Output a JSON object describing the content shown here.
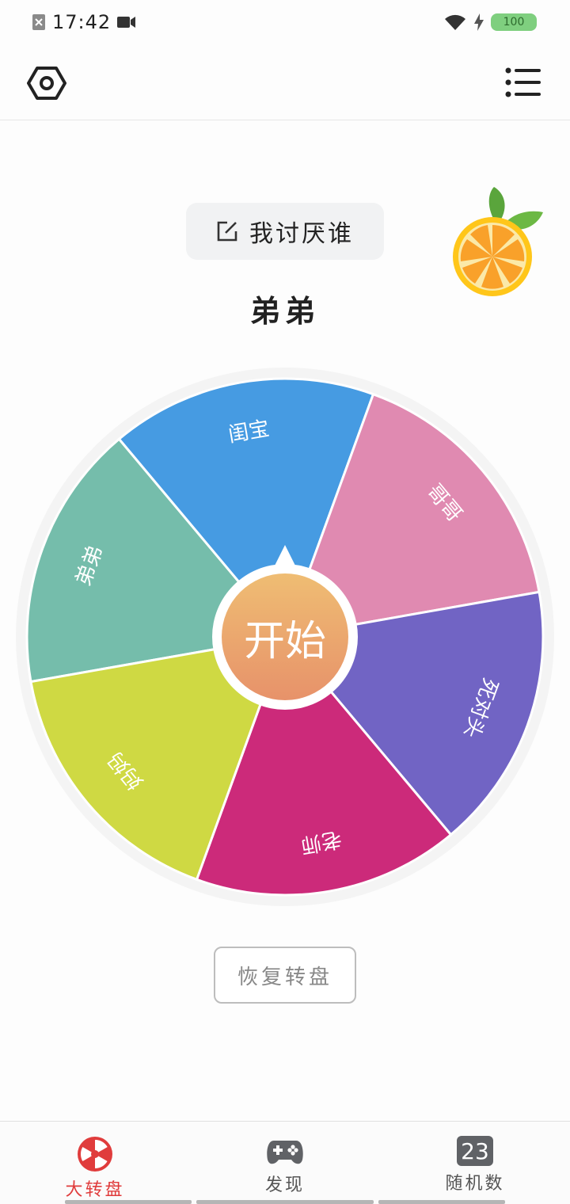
{
  "status_bar": {
    "time": "17:42",
    "battery": "100"
  },
  "header": {
    "settings_icon": "gear-hexagon-icon",
    "menu_icon": "list-icon"
  },
  "title": {
    "text": "我讨厌谁",
    "icon": "edit-icon"
  },
  "result": "弟弟",
  "wheel": {
    "start_label": "开始",
    "segments": [
      {
        "label": "弟弟",
        "color": "#75bdab"
      },
      {
        "label": "闺宝",
        "color": "#469be2"
      },
      {
        "label": "哥哥",
        "color": "#e08ab1"
      },
      {
        "label": "死对头",
        "color": "#7164c4"
      },
      {
        "label": "老师",
        "color": "#cc2a7a"
      },
      {
        "label": "妈妈",
        "color": "#cfd943"
      }
    ]
  },
  "reset_button": "恢复转盘",
  "bottom_nav": [
    {
      "label": "大转盘",
      "icon": "wheel-icon",
      "active": true,
      "color": "#e03c3c"
    },
    {
      "label": "发现",
      "icon": "gamepad-icon",
      "active": false,
      "color": "#555555"
    },
    {
      "label": "随机数",
      "icon": "number-23-icon",
      "icon_text": "23",
      "active": false,
      "color": "#555555"
    }
  ]
}
